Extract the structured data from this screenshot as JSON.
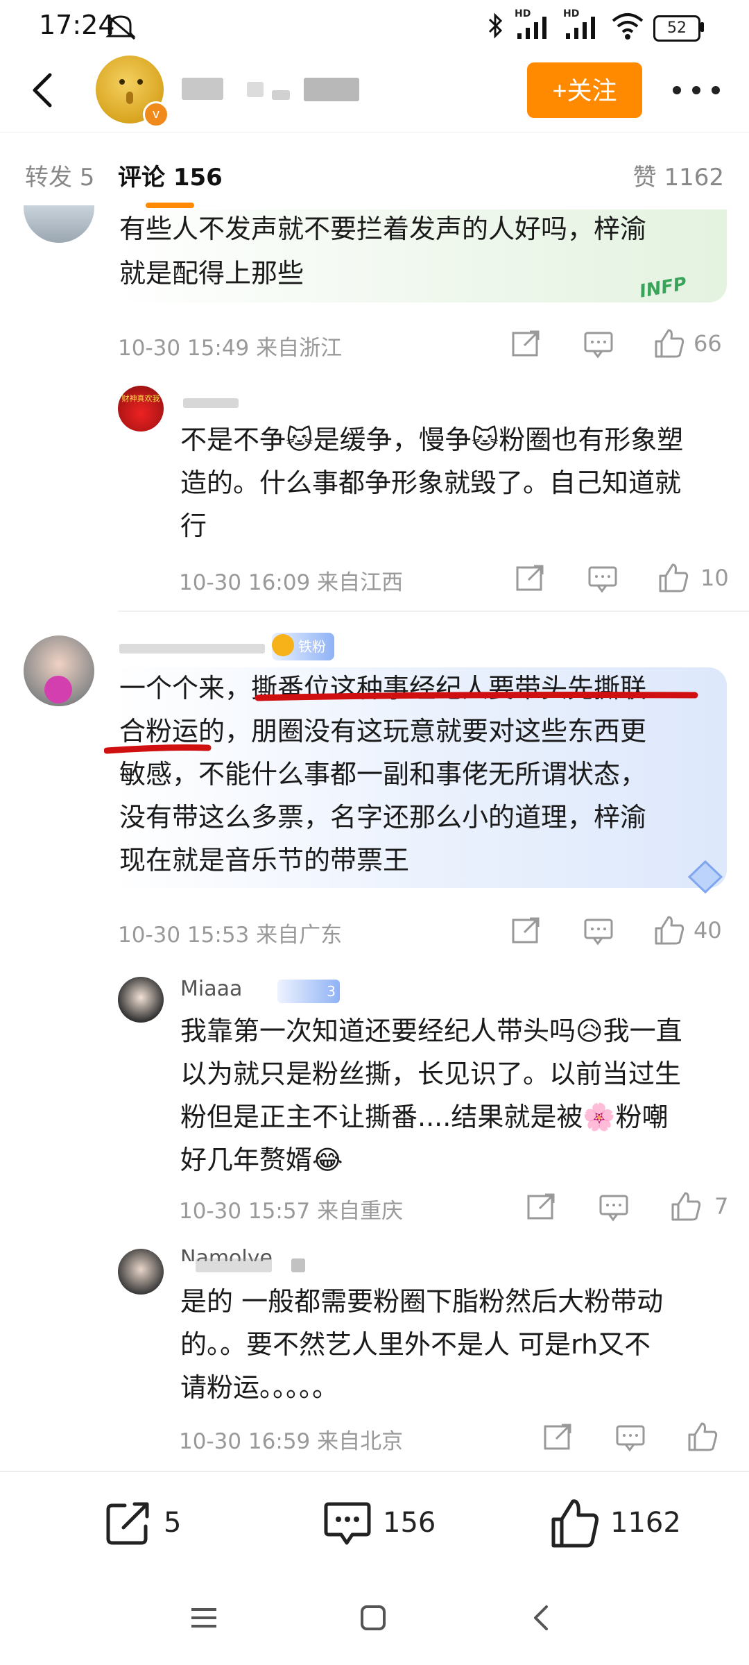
{
  "status_bar": {
    "time": "17:24",
    "battery": "52",
    "network_labels": [
      "HD",
      "HD"
    ]
  },
  "header": {
    "follow_label": "+关注"
  },
  "tabs": {
    "repost": "转发 5",
    "comments": "评论 156",
    "likes": "赞 1162"
  },
  "comments": [
    {
      "text_lines": [
        "有些人不发声就不要拦着发声的人好吗，梓渝",
        "就是配得上那些"
      ],
      "meta": "10-30 15:49  来自浙江",
      "likes": "66",
      "sticker_text": "INFP",
      "replies": [
        {
          "text_lines": [
            "不是不争🐱是缓争，慢争🐱粉圈也有形象塑",
            "造的。什么事都争形象就毁了。自己知道就",
            "行"
          ],
          "meta": "10-30 16:09  来自江西",
          "likes": "10",
          "avatar_text": "财神真欢我"
        }
      ]
    },
    {
      "badge": "铁粉4",
      "text_lines": [
        "一个个来，撕番位这种事经纪人要带头先撕联",
        "合粉运的，朋圈没有这玩意就要对这些东西更",
        "敏感，不能什么事都一副和事佬无所谓状态，",
        "没有带这么多票，名字还那么小的道理，梓渝",
        "现在就是音乐节的带票王"
      ],
      "meta": "10-30 15:53  来自广东",
      "likes": "40",
      "replies": [
        {
          "username": "Miaaa",
          "badge": "3",
          "text_lines": [
            "我靠第一次知道还要经纪人带头吗😥我一直",
            "以为就只是粉丝撕，长见识了。以前当过生",
            "粉但是正主不让撕番....结果就是被🌸粉嘲",
            "好几年赘婿😂"
          ],
          "meta": "10-30 15:57  来自重庆",
          "likes": "7"
        },
        {
          "username": "Namolye",
          "text_lines": [
            "是的 一般都需要粉圈下脂粉然后大粉带动",
            "的。。要不然艺人里外不是人  可是rh又不",
            "请粉运。。。。。"
          ],
          "meta": "10-30 16:59  来自北京",
          "likes": ""
        }
      ]
    }
  ],
  "bottom_bar": {
    "reposts": "5",
    "comments": "156",
    "likes": "1162"
  },
  "colors": {
    "accent": "#ff8a00",
    "highlight_ink": "#d01010",
    "bubble_green": "#eef7ec",
    "bubble_blue": "#eaf1fd"
  }
}
